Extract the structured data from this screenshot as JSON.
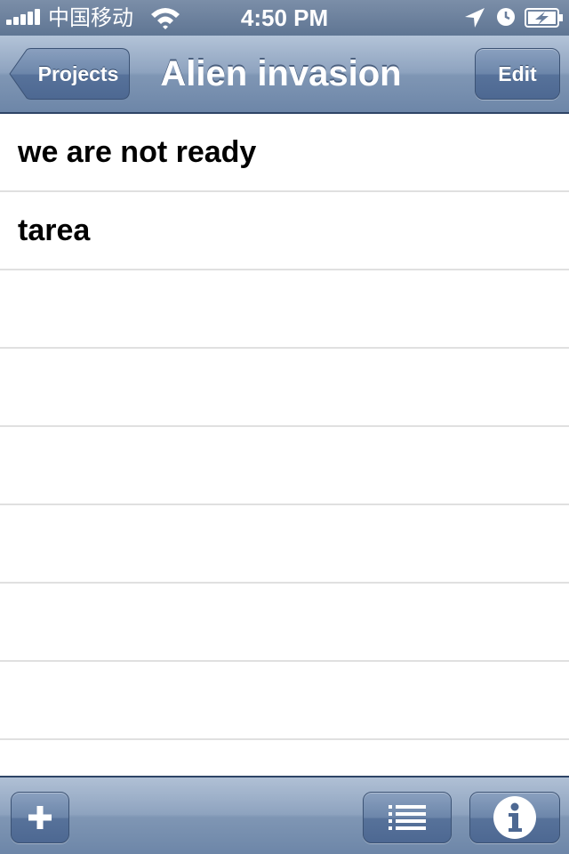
{
  "status_bar": {
    "carrier": "中国移动",
    "time": "4:50 PM",
    "icons": [
      "signal-bars-icon",
      "wifi-icon",
      "location-arrow-icon",
      "alarm-clock-icon",
      "battery-charging-icon"
    ]
  },
  "nav_bar": {
    "back_label": "Projects",
    "title": "Alien invasion",
    "edit_label": "Edit"
  },
  "tasks": [
    {
      "label": "we are not ready"
    },
    {
      "label": "tarea"
    }
  ],
  "toolbar": {
    "icons": [
      "plus-icon",
      "list-icon",
      "info-icon"
    ]
  },
  "colors": {
    "bar_blue": "#6d86a8",
    "bar_border": "#2e4466",
    "separator": "#e0e0e0"
  }
}
